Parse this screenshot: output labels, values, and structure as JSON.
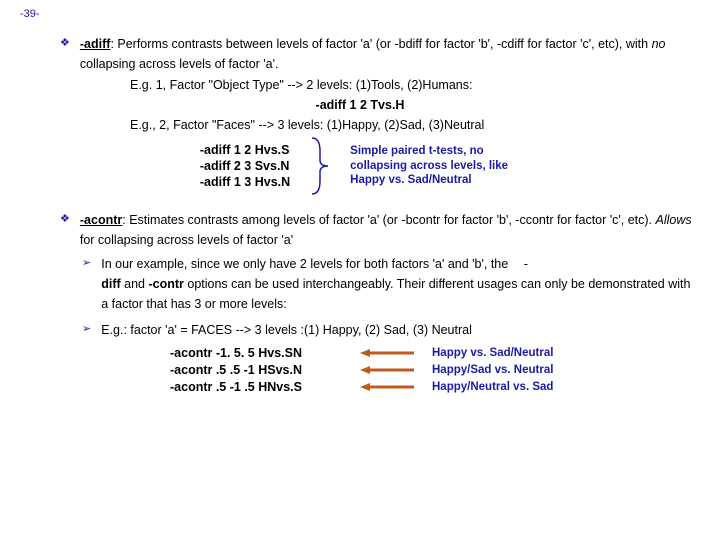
{
  "page_num": "-39-",
  "adiff": {
    "label": "-adiff",
    "desc1": ": Performs contrasts between levels of factor 'a' (or -bdiff for factor 'b', -cdiff for factor 'c', etc), with ",
    "no_word": "no",
    "desc2": " collapsing across levels of factor 'a'.",
    "eg1": "E.g. 1,  Factor \"Object Type\" --> 2 levels: (1)Tools, (2)Humans:",
    "ex1": "-adiff 1 2 Tvs.H",
    "eg2": "E.g., 2, Factor \"Faces\" --> 3 levels: (1)Happy, (2)Sad, (3)Neutral",
    "lines": [
      "-adiff 1 2 Hvs.S",
      "-adiff 2 3 Svs.N",
      "-adiff 1 3 Hvs.N"
    ],
    "callout": "Simple paired t-tests, no collapsing across levels, like Happy vs. Sad/Neutral"
  },
  "acontr": {
    "label": "-acontr",
    "desc1": ": Estimates contrasts among levels of factor 'a' (or -bcontr for factor 'b', -ccontr for factor 'c', etc). ",
    "allows": "Allows",
    "desc2": " for collapsing across levels of factor 'a'",
    "sub1a": "In our example, since we only have 2 levels for both factors 'a' and 'b', the ",
    "sub1dash": "-",
    "sub1b": "diff",
    "sub1c": " and ",
    "sub1d": "-contr",
    "sub1e": " options can be used interchangeably.  Their different usages can only be demonstrated with a factor that has 3 or more levels:",
    "sub2": "E.g.:  factor 'a' = FACES  --> 3 levels :(1) Happy, (2) Sad, (3) Neutral",
    "rows": [
      {
        "left": "-acontr -1. 5. 5 Hvs.SN",
        "right": "Happy vs. Sad/Neutral"
      },
      {
        "left": "-acontr .5 .5 -1 HSvs.N",
        "right": "Happy/Sad vs. Neutral"
      },
      {
        "left": "-acontr .5 -1 .5 HNvs.S",
        "right": "Happy/Neutral vs. Sad"
      }
    ]
  }
}
